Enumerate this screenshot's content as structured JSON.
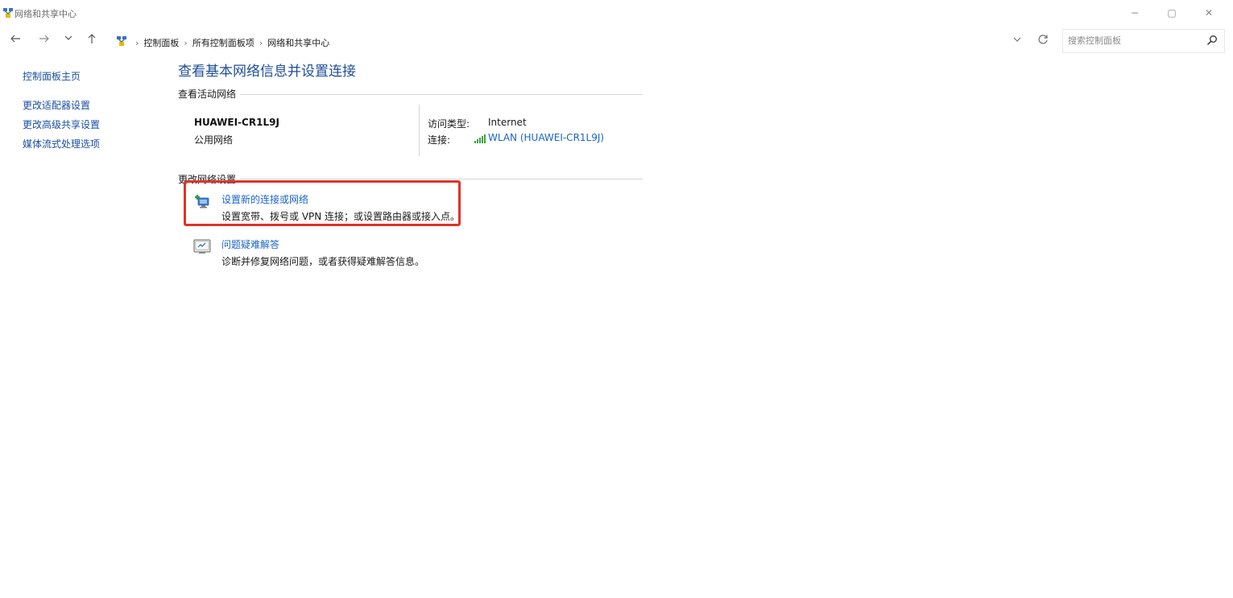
{
  "window": {
    "title": "网络和共享中心",
    "controls": {
      "minimize": "−",
      "maximize": "▢",
      "close": "✕"
    }
  },
  "navigation": {
    "back_icon": "arrow-left-icon",
    "forward_icon": "arrow-right-icon",
    "recent_icon": "chevron-down-icon",
    "up_icon": "arrow-up-icon"
  },
  "address": {
    "breadcrumbs": [
      "控制面板",
      "所有控制面板项",
      "网络和共享中心"
    ],
    "separator": "›"
  },
  "search": {
    "placeholder": "搜索控制面板",
    "value": ""
  },
  "sidebar": {
    "home": "控制面板主页",
    "links": [
      "更改适配器设置",
      "更改高级共享设置",
      "媒体流式处理选项"
    ]
  },
  "main": {
    "title": "查看基本网络信息并设置连接",
    "active_section": {
      "heading": "查看活动网络",
      "network_name": "HUAWEI-CR1L9J",
      "network_type": "公用网络",
      "access_type_label": "访问类型:",
      "access_type_value": "Internet",
      "connection_label": "连接:",
      "connection_value": "WLAN (HUAWEI-CR1L9J)"
    },
    "change_section": {
      "heading": "更改网络设置",
      "tasks": [
        {
          "title": "设置新的连接或网络",
          "description": "设置宽带、拨号或 VPN 连接；或设置路由器或接入点。",
          "icon": "new-connection-icon"
        },
        {
          "title": "问题疑难解答",
          "description": "诊断并修复网络问题，或者获得疑难解答信息。",
          "icon": "troubleshoot-icon"
        }
      ]
    }
  },
  "colors": {
    "link": "#1a64c8",
    "title": "#1e4e99",
    "highlight": "#e0322a",
    "signal": "#3aa53a"
  }
}
